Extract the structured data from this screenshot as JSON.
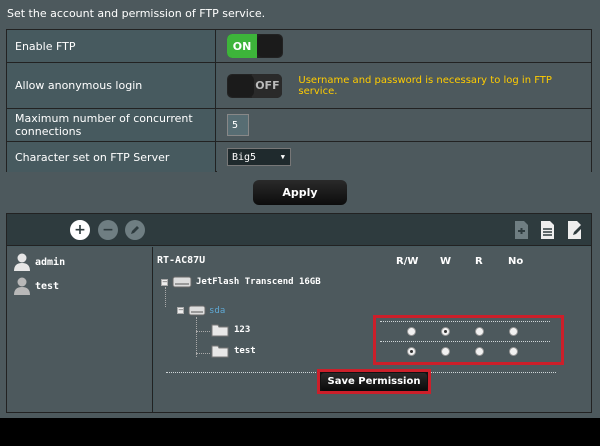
{
  "page": {
    "description": "Set the account and permission of FTP service."
  },
  "settings": {
    "enable_ftp": {
      "label": "Enable FTP",
      "state_text": "ON"
    },
    "anonymous": {
      "label": "Allow anonymous login",
      "state_text": "OFF",
      "notice": "Username and password is necessary to log in FTP service."
    },
    "max_conn": {
      "label": "Maximum number of concurrent connections",
      "value": "5"
    },
    "charset": {
      "label": "Character set on FTP Server",
      "value": "Big5"
    }
  },
  "apply_label": "Apply",
  "toolbar": {
    "icons": [
      "add-user-icon",
      "delete-user-icon",
      "edit-user-icon",
      "add-folder-icon",
      "delete-folder-icon",
      "edit-folder-icon"
    ]
  },
  "users": [
    "admin",
    "test"
  ],
  "tree": {
    "device": "RT-AC87U",
    "columns": [
      "R/W",
      "W",
      "R",
      "No"
    ],
    "drive": "JetFlash Transcend 16GB",
    "partition": "sda",
    "folders": [
      {
        "name": "123",
        "selected": "W"
      },
      {
        "name": "test",
        "selected": "R/W"
      }
    ]
  },
  "save_label": "Save Permission",
  "colors": {
    "toggle_on": "#3db43a",
    "notice": "#ffcc00",
    "highlight": "#cc1f2a",
    "background": "#4d595d"
  }
}
